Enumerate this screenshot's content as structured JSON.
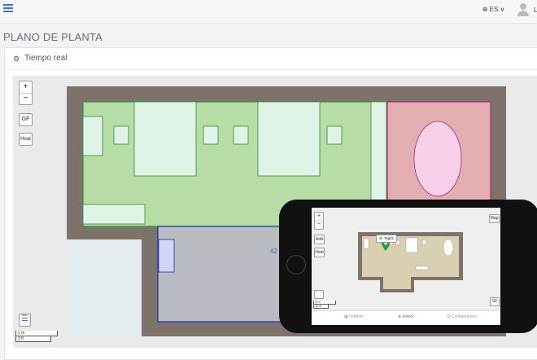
{
  "topbar": {
    "menu_icon": "hamburger-icon",
    "language": "ES",
    "language_icon": "globe-icon",
    "user_icon": "user-avatar-icon",
    "user_name_fragment": "L"
  },
  "page": {
    "title": "PLANO DE PLANTA"
  },
  "panel": {
    "header": "Tiempo real",
    "header_icon": "gears-icon"
  },
  "map_controls": {
    "zoom_in": "+",
    "zoom_out": "−",
    "floor": "GF",
    "heat": "Heat",
    "legend_icon": "list-icon",
    "scale_metric": "1 m",
    "scale_imperial": "3 ft"
  },
  "map": {
    "marker_label": "42"
  },
  "colors": {
    "room_green": "#b8dca5",
    "room_green_border": "#2e8a3a",
    "room_pink": "#e3aeb2",
    "room_pink_border": "#b0207a",
    "room_gray": "#b9bcc2",
    "room_gray_border": "#1f2fa8",
    "wall": "#7d736b",
    "accent": "#3a78c2"
  },
  "phone": {
    "controls": {
      "zoom_in": "+",
      "zoom_out": "−",
      "add": "Add",
      "heat": "Heat",
      "map_btn": "Map",
      "floor": "GF",
      "scale_metric": "3 m",
      "scale_imperial": "10 ft"
    },
    "marker_tooltip": "id: Tag01",
    "nav": [
      {
        "label": "Outdoor",
        "icon": "map-icon",
        "active": false
      },
      {
        "label": "Indoor",
        "icon": "location-arrow-icon",
        "active": true
      },
      {
        "label": "Configuración",
        "icon": "gear-icon",
        "active": false
      }
    ]
  }
}
